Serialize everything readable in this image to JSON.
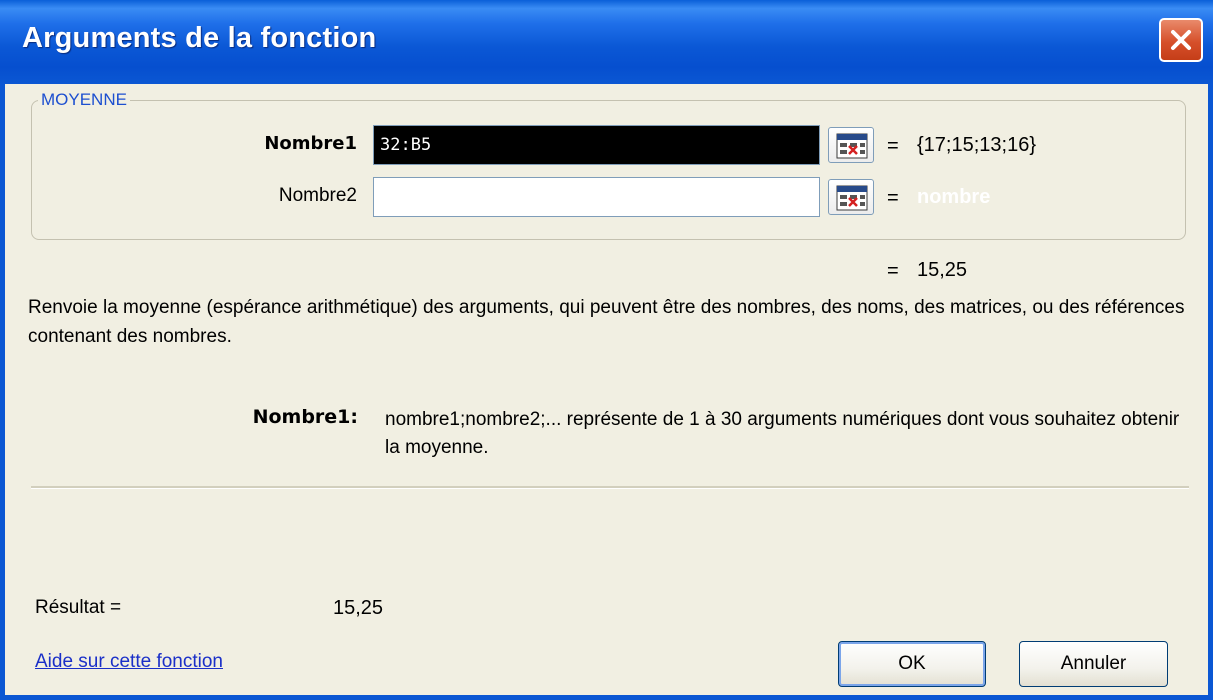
{
  "window": {
    "title": "Arguments de la fonction",
    "close_icon": "close-icon"
  },
  "function_group": {
    "name": "MOYENNE",
    "args": [
      {
        "label": "Nombre1",
        "value": "32:B5",
        "preview": "{17;15;13;16}",
        "equals": "="
      },
      {
        "label": "Nombre2",
        "value": "",
        "preview": "nombre",
        "equals": "="
      }
    ],
    "collapse_icon": "range-selector-icon"
  },
  "formula_result": {
    "equals": "=",
    "value": "15,25"
  },
  "description": "Renvoie la moyenne (espérance arithmétique) des arguments, qui peuvent être des nombres, des noms, des matrices, ou des références contenant des nombres.",
  "arg_help": {
    "label": "Nombre1:",
    "text": "nombre1;nombre2;... représente de 1 à 30 arguments numériques dont vous souhaitez obtenir la moyenne."
  },
  "footer": {
    "result_label": "Résultat =",
    "result_value": "15,25",
    "help_link": "Aide sur cette fonction",
    "ok_label": "OK",
    "cancel_label": "Annuler"
  },
  "colors": {
    "titlebar": "#0b57d3",
    "dialog_bg": "#f1efe2",
    "group_label": "#1d4fd0",
    "link": "#1a2fc8",
    "close_button": "#d6502b"
  }
}
